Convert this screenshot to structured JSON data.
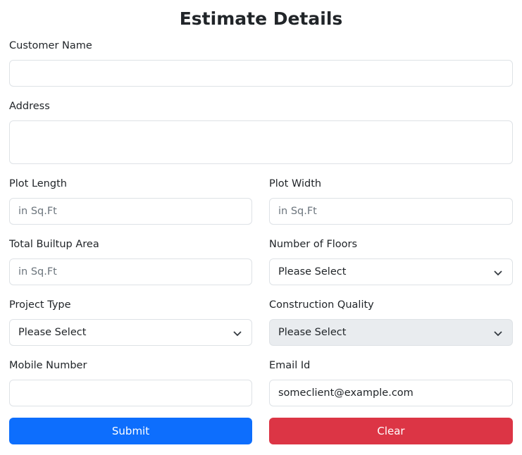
{
  "title": "Estimate Details",
  "fields": {
    "customer_name": {
      "label": "Customer Name",
      "value": ""
    },
    "address": {
      "label": "Address",
      "value": ""
    },
    "plot_length": {
      "label": "Plot Length",
      "placeholder": "in Sq.Ft"
    },
    "plot_width": {
      "label": "Plot Width",
      "placeholder": "in Sq.Ft"
    },
    "builtup_area": {
      "label": "Total Builtup Area",
      "placeholder": "in Sq.Ft"
    },
    "floors": {
      "label": "Number of Floors",
      "selected": "Please Select"
    },
    "project_type": {
      "label": "Project Type",
      "selected": "Please Select"
    },
    "quality": {
      "label": "Construction Quality",
      "selected": "Please Select"
    },
    "mobile": {
      "label": "Mobile Number",
      "value": ""
    },
    "email": {
      "label": "Email Id",
      "value": "someclient@example.com"
    }
  },
  "buttons": {
    "submit": "Submit",
    "clear": "Clear"
  },
  "colors": {
    "submit": "#0d6efd",
    "clear": "#dc3545",
    "disabled_select": "#e9ecef"
  }
}
